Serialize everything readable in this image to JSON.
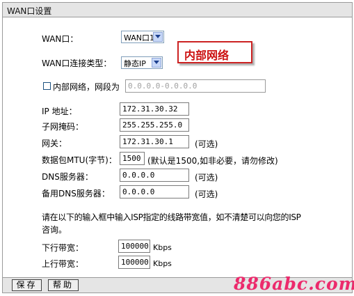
{
  "window": {
    "title": "WAN口设置"
  },
  "form": {
    "wan_port_label": "WAN口：",
    "wan_port_value": "WAN口1",
    "connection_type_label": "WAN口连接类型：",
    "connection_type_value": "静态IP",
    "internal_network_label": "内部网络，网段为",
    "internal_network_value": "0.0.0.0-0.0.0.0",
    "ip_label": "IP 地址：",
    "ip_value": "172.31.30.32",
    "subnet_label": "子网掩码：",
    "subnet_value": "255.255.255.0",
    "gateway_label": "网关：",
    "gateway_value": "172.31.30.1",
    "gateway_note": "(可选)",
    "mtu_label": "数据包MTU(字节)：",
    "mtu_value": "1500",
    "mtu_note": "(默认是1500,如非必要，请勿修改)",
    "dns_label": "DNS服务器：",
    "dns_value": "0.0.0.0",
    "dns_note": "(可选)",
    "dns2_label": "备用DNS服务器：",
    "dns2_value": "0.0.0.0",
    "dns2_note": "(可选)",
    "info_line1": "请在以下的输入框中输入ISP指定的线路带宽值，如不清楚可以向您的ISP",
    "info_line2": "咨询。",
    "downlink_label": "下行带宽：",
    "downlink_value": "100000",
    "downlink_unit": "Kbps",
    "uplink_label": "上行带宽：",
    "uplink_value": "100000",
    "uplink_unit": "Kbps"
  },
  "annotation": {
    "label": "内部网络"
  },
  "buttons": {
    "save_label": "保存",
    "help_label": "帮助"
  },
  "watermark": {
    "text": "886abc.com"
  },
  "colors": {
    "title_bar": "#e5e5e5",
    "annotation_red": "#cc1111",
    "select_button": "#c8d8f8",
    "watermark": "#ec2a6c"
  },
  "icons": {
    "dropdown": "chevron-down-icon",
    "checkbox": "checkbox-unchecked"
  }
}
